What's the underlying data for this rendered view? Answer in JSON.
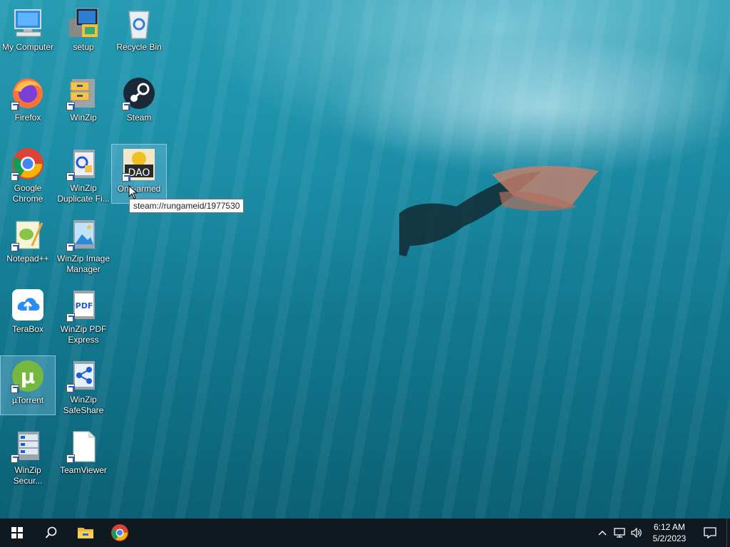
{
  "desktop": {
    "icons": [
      {
        "label": "My Computer"
      },
      {
        "label": "setup"
      },
      {
        "label": "Recycle Bin"
      },
      {
        "label": "Firefox"
      },
      {
        "label": "WinZip"
      },
      {
        "label": "Steam"
      },
      {
        "label": "Google Chrome"
      },
      {
        "label": "WinZip Duplicate Fi..."
      },
      {
        "label": "One-armed"
      },
      {
        "label": "Notepad++"
      },
      {
        "label": "WinZip Image Manager"
      },
      {
        "label": "TeraBox"
      },
      {
        "label": "WinZip PDF Express"
      },
      {
        "label": "µTorrent"
      },
      {
        "label": "WinZip SafeShare"
      },
      {
        "label": "WinZip Secur..."
      },
      {
        "label": "TeamViewer"
      }
    ]
  },
  "tooltip": {
    "text": "steam://rungameid/1977530"
  },
  "taskbar": {
    "clock": {
      "time": "6:12 AM",
      "date": "5/2/2023"
    }
  },
  "colors": {
    "taskbar": "#101820",
    "accent": "#1e5bd8"
  }
}
